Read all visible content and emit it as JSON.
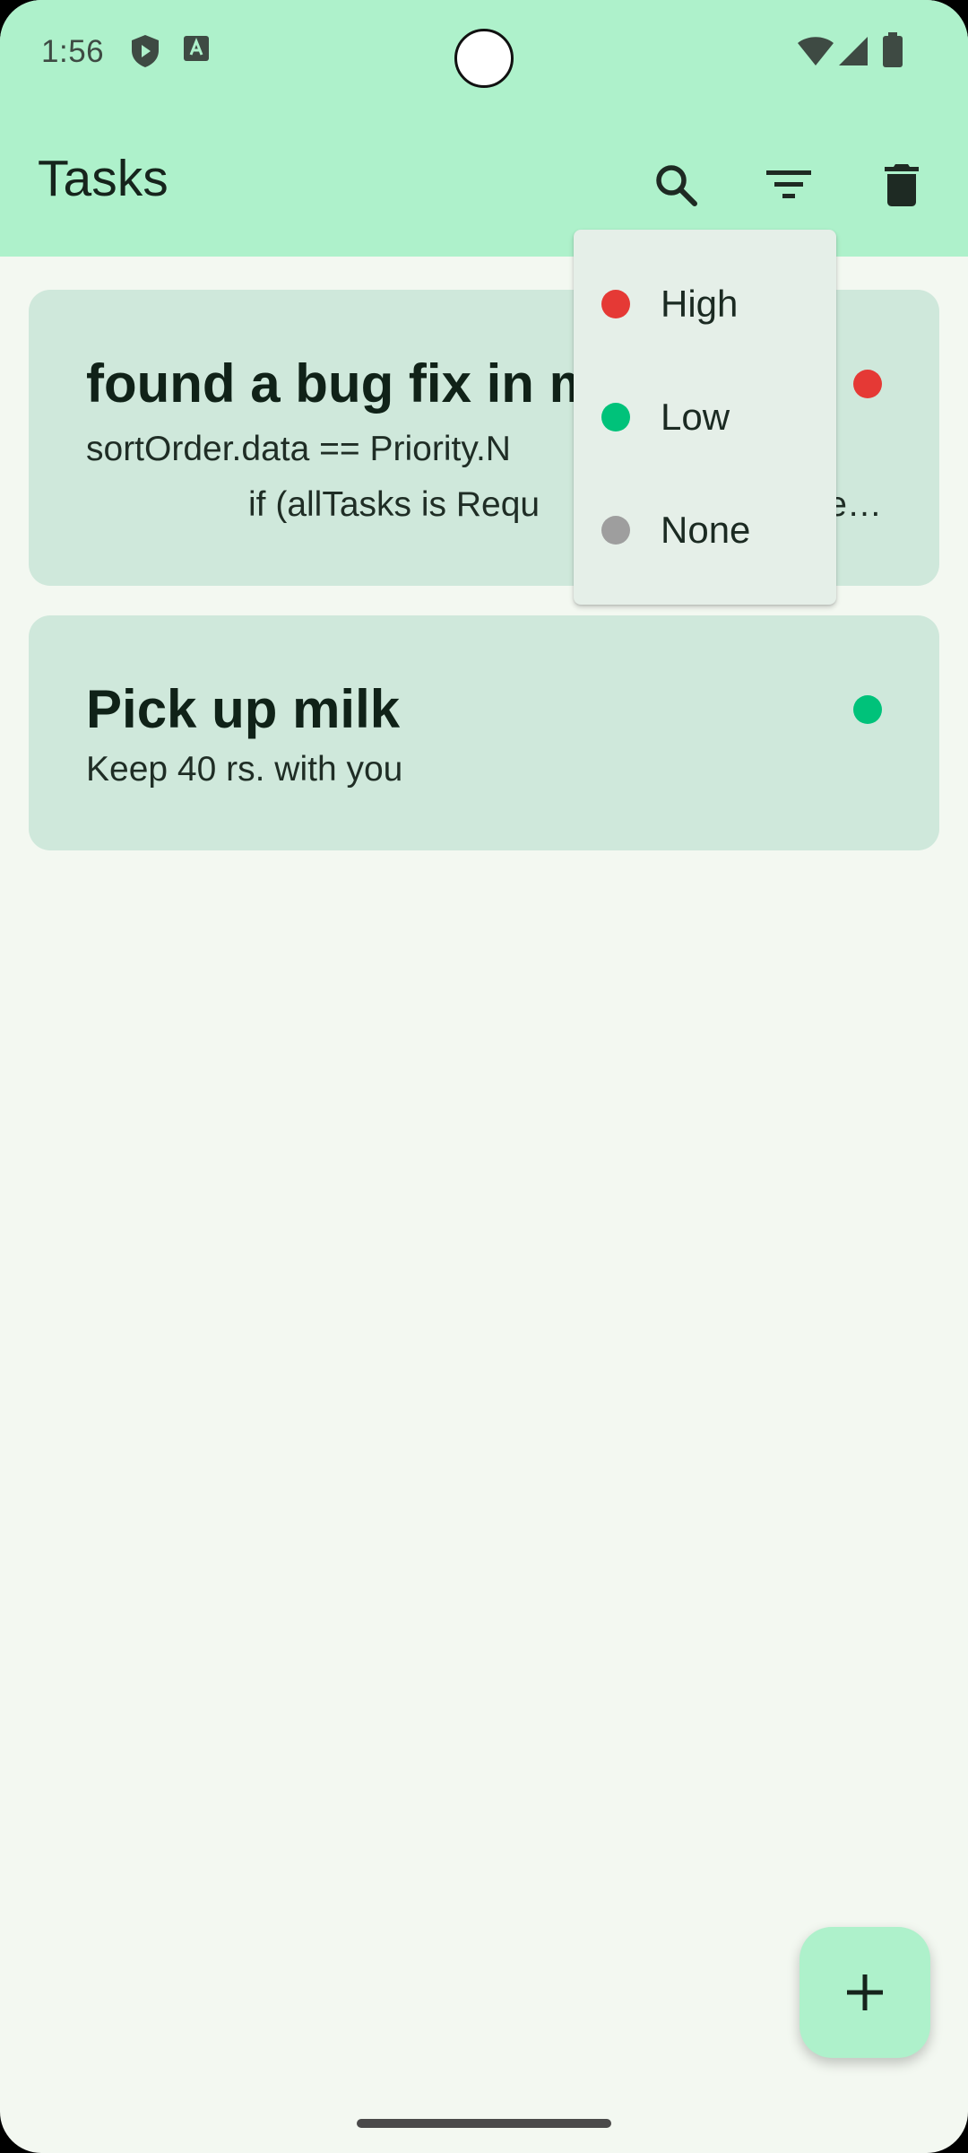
{
  "status_bar": {
    "time": "1:56",
    "icons": [
      "shield-icon",
      "keyboard-a-icon",
      "wifi-icon",
      "signal-icon",
      "battery-icon"
    ]
  },
  "app_bar": {
    "title": "Tasks",
    "actions": [
      "search-icon",
      "filter-icon",
      "delete-icon"
    ]
  },
  "tasks": [
    {
      "title": "found a bug fix in m",
      "description_line1": "sortOrder.data == Priority.N",
      "description_line2": "if (allTasks is Requ",
      "description_line2_tail": "e…",
      "priority": "High"
    },
    {
      "title": "Pick up milk",
      "description_line1": "Keep 40 rs. with you",
      "priority": "Low"
    }
  ],
  "filter_menu": {
    "items": [
      {
        "label": "High",
        "color": "#e53935"
      },
      {
        "label": "Low",
        "color": "#00c27a"
      },
      {
        "label": "None",
        "color": "#9e9e9e"
      }
    ]
  },
  "colors": {
    "app_bar": "#aef1cb",
    "background": "#f3f8f1",
    "card": "#cfe8db",
    "high": "#e53935",
    "low": "#00c27a",
    "none": "#9e9e9e"
  },
  "fab": {
    "icon": "plus-icon"
  }
}
